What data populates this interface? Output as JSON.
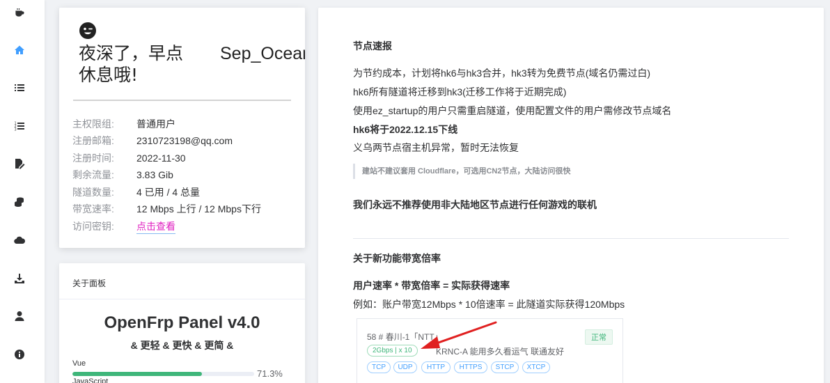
{
  "sidebar": {
    "items": [
      {
        "icon": "coffee-icon",
        "active": false
      },
      {
        "icon": "home-icon",
        "active": true
      },
      {
        "icon": "list-icon",
        "active": false
      },
      {
        "icon": "ordered-list-icon",
        "active": false
      },
      {
        "icon": "edit-file-icon",
        "active": false
      },
      {
        "icon": "coins-icon",
        "active": false
      },
      {
        "icon": "cloud-icon",
        "active": false
      },
      {
        "icon": "download-icon",
        "active": false
      },
      {
        "icon": "user-icon",
        "active": false
      },
      {
        "icon": "info-icon",
        "active": false
      }
    ],
    "accent": "#409eff",
    "icon_color": "#303133"
  },
  "user": {
    "greeting": "夜深了，早点休息哦!",
    "username": "Sep_Ocean",
    "fields": [
      {
        "label": "主权限组:",
        "value": "普通用户"
      },
      {
        "label": "注册邮箱:",
        "value": "2310723198@qq.com"
      },
      {
        "label": "注册时间:",
        "value": "2022-11-30"
      },
      {
        "label": "剩余流量:",
        "value": "3.83 Gib"
      },
      {
        "label": "隧道数量:",
        "value": "4 已用 / 4 总量"
      },
      {
        "label": "带宽速率:",
        "value": "12 Mbps 上行 / 12 Mbps下行"
      },
      {
        "label": "访问密钥:",
        "value": "点击查看"
      }
    ]
  },
  "about": {
    "header": "关于面板",
    "title": "OpenFrp Panel v4.0",
    "subtitle": "& 更轻 & 更快 & 更简 &",
    "langs": [
      {
        "name": "Vue",
        "percent": 71.3,
        "percent_text": "71.3%"
      },
      {
        "name": "JavaScript"
      }
    ]
  },
  "notice": {
    "title1": "节点速报",
    "lines": [
      "为节约成本，计划将hk6与hk3合并，hk3转为免费节点(域名仍需过白)",
      "hk6所有隧道将迁移到hk3(迁移工作将于近期完成)",
      "使用ez_startup的用户只需重启隧道，使用配置文件的用户需修改节点域名"
    ],
    "bold_line": "hk6将于2022.12.15下线",
    "line5": "义乌两节点宿主机异常，暂时无法恢复",
    "quote": "建站不建议套用 Cloudflare，可选用CN2节点，大陆访问很快",
    "bold2": "我们永远不推荐使用非大陆地区节点进行任何游戏的联机",
    "title2": "关于新功能带宽倍率",
    "formula": "用户速率 * 带宽倍率 = 实际获得速率",
    "example": "例如：账户带宽12Mbps * 10倍速率 = 此隧道实际获得120Mbps",
    "node": {
      "name": "58 # 春川-1「NTT」",
      "status": "正常",
      "tag": "2Gbps | x 10",
      "desc": "KRNC-A 能用多久看运气 联通友好",
      "protocols": [
        "TCP",
        "UDP",
        "HTTP",
        "HTTPS",
        "STCP",
        "XTCP"
      ]
    }
  }
}
